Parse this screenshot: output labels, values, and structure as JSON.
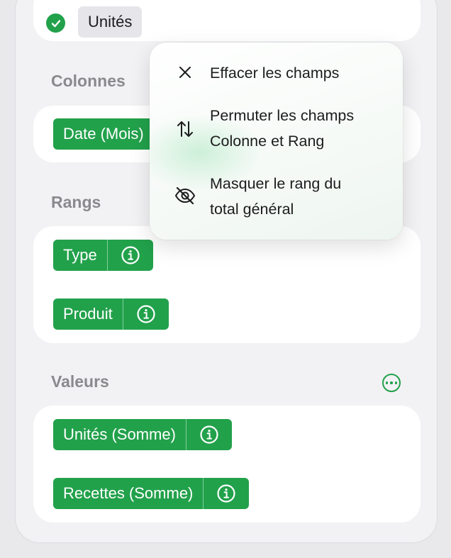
{
  "top_field": {
    "label": "Unités"
  },
  "sections": {
    "columns": {
      "title": "Colonnes",
      "fields": [
        "Date (Mois)"
      ]
    },
    "rows": {
      "title": "Rangs",
      "fields": [
        "Type",
        "Produit"
      ]
    },
    "values": {
      "title": "Valeurs",
      "fields": [
        "Unités (Somme)",
        "Recettes (Somme)"
      ]
    }
  },
  "menu": {
    "items": [
      {
        "icon": "close-icon",
        "line1": "Effacer les champs",
        "line2": ""
      },
      {
        "icon": "swap-arrows-icon",
        "line1": "Permuter les champs",
        "line2": "Colonne et Rang"
      },
      {
        "icon": "eye-slash-icon",
        "line1": "Masquer le rang du",
        "line2": "total général"
      }
    ]
  },
  "colors": {
    "accent_green": "#22a14b",
    "section_title": "#8a8a8e",
    "menu_bg": "#ffffff"
  }
}
